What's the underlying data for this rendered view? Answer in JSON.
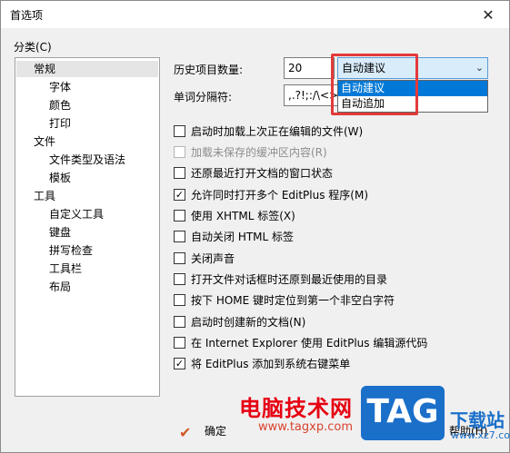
{
  "window": {
    "title": "首选项",
    "close": "✕"
  },
  "category": {
    "label": "分类(C)",
    "items": [
      {
        "label": "常规"
      },
      {
        "label": "字体"
      },
      {
        "label": "颜色"
      },
      {
        "label": "打印"
      },
      {
        "label": "文件"
      },
      {
        "label": "文件类型及语法"
      },
      {
        "label": "模板"
      },
      {
        "label": "工具"
      },
      {
        "label": "自定义工具"
      },
      {
        "label": "键盘"
      },
      {
        "label": "拼写检查"
      },
      {
        "label": "工具栏"
      },
      {
        "label": "布局"
      }
    ]
  },
  "history": {
    "label": "历史项目数量:",
    "value": "20"
  },
  "word_sep": {
    "label": "单词分隔符:",
    "value": ",.?!;:/\\<>("
  },
  "select": {
    "value": "自动建议",
    "arrow": "⌄",
    "options": [
      {
        "label": "自动建议"
      },
      {
        "label": "自动追加"
      }
    ]
  },
  "options": [
    {
      "label": "启动时加载上次正在编辑的文件(W)",
      "checked": ""
    },
    {
      "label": "加载未保存的缓冲区内容(R)",
      "checked": ""
    },
    {
      "label": "还原最近打开文档的窗口状态",
      "checked": ""
    },
    {
      "label": "允许同时打开多个 EditPlus 程序(M)",
      "checked": "✓"
    },
    {
      "label": "使用 XHTML 标签(X)",
      "checked": ""
    },
    {
      "label": "自动关闭 HTML 标签",
      "checked": ""
    },
    {
      "label": "关闭声音",
      "checked": ""
    },
    {
      "label": "打开文件对话框时还原到最近使用的目录",
      "checked": ""
    },
    {
      "label": "按下 HOME 键时定位到第一个非空白字符",
      "checked": ""
    },
    {
      "label": "启动时创建新的文档(N)",
      "checked": ""
    },
    {
      "label": "在 Internet Explorer 使用 EditPlus 编辑源代码",
      "checked": ""
    },
    {
      "label": "将 EditPlus 添加到系统右键菜单",
      "checked": "✓"
    }
  ],
  "buttons": {
    "ok": "确定",
    "help": "帮助(H)"
  },
  "watermark": {
    "site_name": "电脑技术网",
    "site_url": "www.tagxp.com",
    "tag": "TAG",
    "download": "下载站",
    "download_url": "www.xz7.com"
  },
  "colors": {
    "highlight": "#0078d7",
    "outline": "#e43a3a",
    "tag_blue": "#1a6fc9"
  }
}
